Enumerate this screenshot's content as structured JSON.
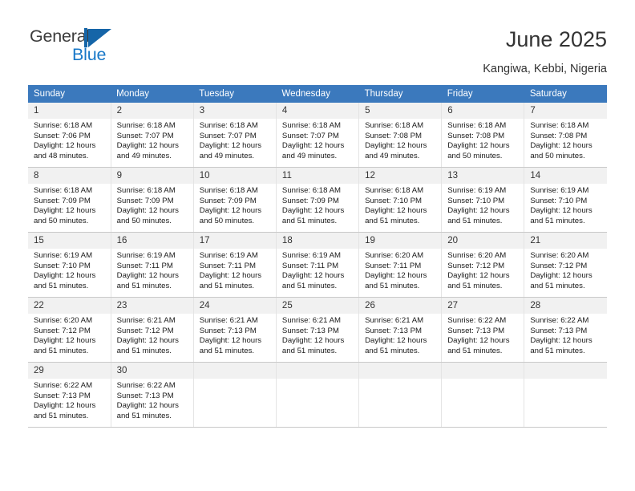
{
  "brand": {
    "name_part1": "General",
    "name_part2": "Blue",
    "mark": "triangle-logo-icon",
    "accent_color": "#1878c8",
    "mark_color": "#1565a8"
  },
  "header": {
    "title": "June 2025",
    "location": "Kangiwa, Kebbi, Nigeria"
  },
  "theme": {
    "header_row_bg": "#3b79bd",
    "header_row_text": "#ffffff",
    "daynum_bg": "#f1f1f1",
    "cell_border": "#c9c9c9"
  },
  "calendar": {
    "weekday_headers": [
      "Sunday",
      "Monday",
      "Tuesday",
      "Wednesday",
      "Thursday",
      "Friday",
      "Saturday"
    ],
    "weeks": [
      [
        {
          "day": "1",
          "sunrise": "Sunrise: 6:18 AM",
          "sunset": "Sunset: 7:06 PM",
          "daylight_line1": "Daylight: 12 hours",
          "daylight_line2": "and 48 minutes."
        },
        {
          "day": "2",
          "sunrise": "Sunrise: 6:18 AM",
          "sunset": "Sunset: 7:07 PM",
          "daylight_line1": "Daylight: 12 hours",
          "daylight_line2": "and 49 minutes."
        },
        {
          "day": "3",
          "sunrise": "Sunrise: 6:18 AM",
          "sunset": "Sunset: 7:07 PM",
          "daylight_line1": "Daylight: 12 hours",
          "daylight_line2": "and 49 minutes."
        },
        {
          "day": "4",
          "sunrise": "Sunrise: 6:18 AM",
          "sunset": "Sunset: 7:07 PM",
          "daylight_line1": "Daylight: 12 hours",
          "daylight_line2": "and 49 minutes."
        },
        {
          "day": "5",
          "sunrise": "Sunrise: 6:18 AM",
          "sunset": "Sunset: 7:08 PM",
          "daylight_line1": "Daylight: 12 hours",
          "daylight_line2": "and 49 minutes."
        },
        {
          "day": "6",
          "sunrise": "Sunrise: 6:18 AM",
          "sunset": "Sunset: 7:08 PM",
          "daylight_line1": "Daylight: 12 hours",
          "daylight_line2": "and 50 minutes."
        },
        {
          "day": "7",
          "sunrise": "Sunrise: 6:18 AM",
          "sunset": "Sunset: 7:08 PM",
          "daylight_line1": "Daylight: 12 hours",
          "daylight_line2": "and 50 minutes."
        }
      ],
      [
        {
          "day": "8",
          "sunrise": "Sunrise: 6:18 AM",
          "sunset": "Sunset: 7:09 PM",
          "daylight_line1": "Daylight: 12 hours",
          "daylight_line2": "and 50 minutes."
        },
        {
          "day": "9",
          "sunrise": "Sunrise: 6:18 AM",
          "sunset": "Sunset: 7:09 PM",
          "daylight_line1": "Daylight: 12 hours",
          "daylight_line2": "and 50 minutes."
        },
        {
          "day": "10",
          "sunrise": "Sunrise: 6:18 AM",
          "sunset": "Sunset: 7:09 PM",
          "daylight_line1": "Daylight: 12 hours",
          "daylight_line2": "and 50 minutes."
        },
        {
          "day": "11",
          "sunrise": "Sunrise: 6:18 AM",
          "sunset": "Sunset: 7:09 PM",
          "daylight_line1": "Daylight: 12 hours",
          "daylight_line2": "and 51 minutes."
        },
        {
          "day": "12",
          "sunrise": "Sunrise: 6:18 AM",
          "sunset": "Sunset: 7:10 PM",
          "daylight_line1": "Daylight: 12 hours",
          "daylight_line2": "and 51 minutes."
        },
        {
          "day": "13",
          "sunrise": "Sunrise: 6:19 AM",
          "sunset": "Sunset: 7:10 PM",
          "daylight_line1": "Daylight: 12 hours",
          "daylight_line2": "and 51 minutes."
        },
        {
          "day": "14",
          "sunrise": "Sunrise: 6:19 AM",
          "sunset": "Sunset: 7:10 PM",
          "daylight_line1": "Daylight: 12 hours",
          "daylight_line2": "and 51 minutes."
        }
      ],
      [
        {
          "day": "15",
          "sunrise": "Sunrise: 6:19 AM",
          "sunset": "Sunset: 7:10 PM",
          "daylight_line1": "Daylight: 12 hours",
          "daylight_line2": "and 51 minutes."
        },
        {
          "day": "16",
          "sunrise": "Sunrise: 6:19 AM",
          "sunset": "Sunset: 7:11 PM",
          "daylight_line1": "Daylight: 12 hours",
          "daylight_line2": "and 51 minutes."
        },
        {
          "day": "17",
          "sunrise": "Sunrise: 6:19 AM",
          "sunset": "Sunset: 7:11 PM",
          "daylight_line1": "Daylight: 12 hours",
          "daylight_line2": "and 51 minutes."
        },
        {
          "day": "18",
          "sunrise": "Sunrise: 6:19 AM",
          "sunset": "Sunset: 7:11 PM",
          "daylight_line1": "Daylight: 12 hours",
          "daylight_line2": "and 51 minutes."
        },
        {
          "day": "19",
          "sunrise": "Sunrise: 6:20 AM",
          "sunset": "Sunset: 7:11 PM",
          "daylight_line1": "Daylight: 12 hours",
          "daylight_line2": "and 51 minutes."
        },
        {
          "day": "20",
          "sunrise": "Sunrise: 6:20 AM",
          "sunset": "Sunset: 7:12 PM",
          "daylight_line1": "Daylight: 12 hours",
          "daylight_line2": "and 51 minutes."
        },
        {
          "day": "21",
          "sunrise": "Sunrise: 6:20 AM",
          "sunset": "Sunset: 7:12 PM",
          "daylight_line1": "Daylight: 12 hours",
          "daylight_line2": "and 51 minutes."
        }
      ],
      [
        {
          "day": "22",
          "sunrise": "Sunrise: 6:20 AM",
          "sunset": "Sunset: 7:12 PM",
          "daylight_line1": "Daylight: 12 hours",
          "daylight_line2": "and 51 minutes."
        },
        {
          "day": "23",
          "sunrise": "Sunrise: 6:21 AM",
          "sunset": "Sunset: 7:12 PM",
          "daylight_line1": "Daylight: 12 hours",
          "daylight_line2": "and 51 minutes."
        },
        {
          "day": "24",
          "sunrise": "Sunrise: 6:21 AM",
          "sunset": "Sunset: 7:13 PM",
          "daylight_line1": "Daylight: 12 hours",
          "daylight_line2": "and 51 minutes."
        },
        {
          "day": "25",
          "sunrise": "Sunrise: 6:21 AM",
          "sunset": "Sunset: 7:13 PM",
          "daylight_line1": "Daylight: 12 hours",
          "daylight_line2": "and 51 minutes."
        },
        {
          "day": "26",
          "sunrise": "Sunrise: 6:21 AM",
          "sunset": "Sunset: 7:13 PM",
          "daylight_line1": "Daylight: 12 hours",
          "daylight_line2": "and 51 minutes."
        },
        {
          "day": "27",
          "sunrise": "Sunrise: 6:22 AM",
          "sunset": "Sunset: 7:13 PM",
          "daylight_line1": "Daylight: 12 hours",
          "daylight_line2": "and 51 minutes."
        },
        {
          "day": "28",
          "sunrise": "Sunrise: 6:22 AM",
          "sunset": "Sunset: 7:13 PM",
          "daylight_line1": "Daylight: 12 hours",
          "daylight_line2": "and 51 minutes."
        }
      ],
      [
        {
          "day": "29",
          "sunrise": "Sunrise: 6:22 AM",
          "sunset": "Sunset: 7:13 PM",
          "daylight_line1": "Daylight: 12 hours",
          "daylight_line2": "and 51 minutes."
        },
        {
          "day": "30",
          "sunrise": "Sunrise: 6:22 AM",
          "sunset": "Sunset: 7:13 PM",
          "daylight_line1": "Daylight: 12 hours",
          "daylight_line2": "and 51 minutes."
        },
        {
          "day": "",
          "sunrise": "",
          "sunset": "",
          "daylight_line1": "",
          "daylight_line2": "",
          "empty": true
        },
        {
          "day": "",
          "sunrise": "",
          "sunset": "",
          "daylight_line1": "",
          "daylight_line2": "",
          "empty": true
        },
        {
          "day": "",
          "sunrise": "",
          "sunset": "",
          "daylight_line1": "",
          "daylight_line2": "",
          "empty": true
        },
        {
          "day": "",
          "sunrise": "",
          "sunset": "",
          "daylight_line1": "",
          "daylight_line2": "",
          "empty": true
        },
        {
          "day": "",
          "sunrise": "",
          "sunset": "",
          "daylight_line1": "",
          "daylight_line2": "",
          "empty": true
        }
      ]
    ]
  }
}
